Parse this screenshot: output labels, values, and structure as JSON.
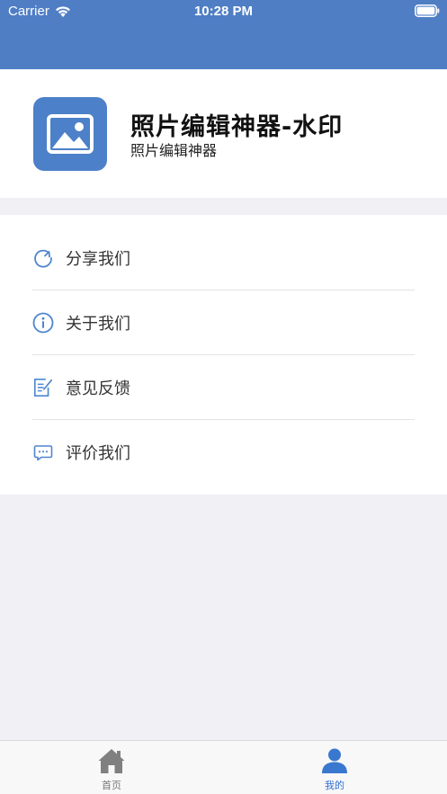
{
  "status_bar": {
    "carrier": "Carrier",
    "time": "10:28 PM",
    "icons": [
      "wifi-icon",
      "battery-icon"
    ]
  },
  "colors": {
    "header": "#4f7ec5",
    "app_icon_bg": "#4c80c8",
    "menu_icon": "#4f86cf",
    "tab_active": "#2f6fcf",
    "tab_inactive": "#777777",
    "page_bg": "#f1f1f5"
  },
  "app": {
    "icon": "image-icon",
    "name": "照片编辑神器-水印",
    "subtitle": "照片编辑神器"
  },
  "menu": {
    "items": [
      {
        "icon": "share-refresh-icon",
        "label": "分享我们"
      },
      {
        "icon": "info-icon",
        "label": "关于我们"
      },
      {
        "icon": "feedback-note-icon",
        "label": "意见反馈"
      },
      {
        "icon": "chat-bubble-icon",
        "label": "评价我们"
      }
    ]
  },
  "tab_bar": {
    "tabs": [
      {
        "icon": "home-icon",
        "label": "首页",
        "active": false
      },
      {
        "icon": "person-icon",
        "label": "我的",
        "active": true
      }
    ]
  }
}
